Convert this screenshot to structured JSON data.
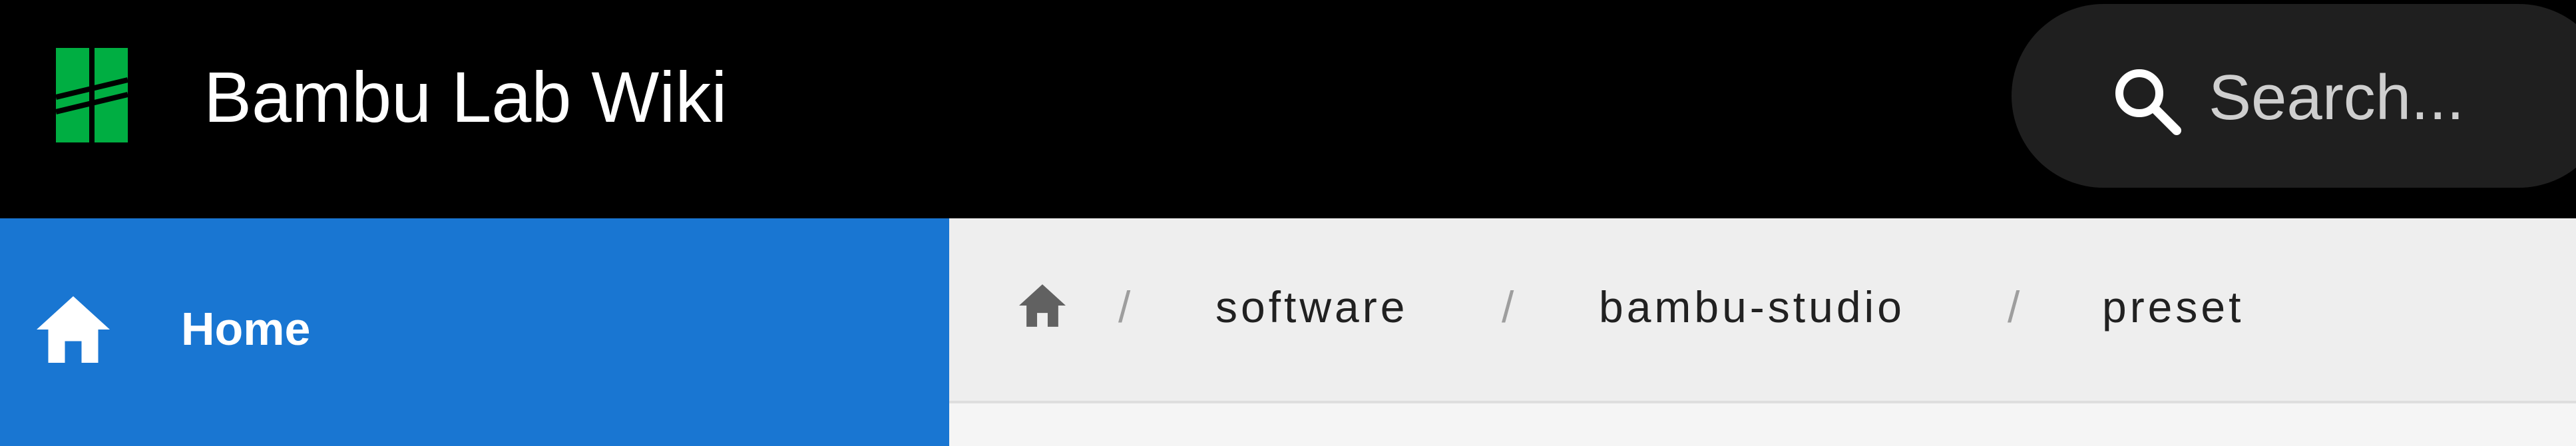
{
  "header": {
    "title": "Bambu Lab Wiki",
    "logo_icon": "bambu-logo-icon",
    "search": {
      "placeholder": "Search...",
      "icon": "search-icon"
    }
  },
  "sidebar": {
    "items": [
      {
        "label": "Home",
        "icon": "home-icon"
      }
    ]
  },
  "breadcrumb": {
    "home_icon": "home-icon",
    "separator": "/",
    "items": [
      "software",
      "bambu-studio",
      "preset"
    ]
  },
  "colors": {
    "topbar": "#000000",
    "brand_green": "#00ae42",
    "sidebar_active": "#1976d2",
    "breadcrumb_bg": "#eeeeee",
    "search_bg": "#1f1f1f"
  }
}
